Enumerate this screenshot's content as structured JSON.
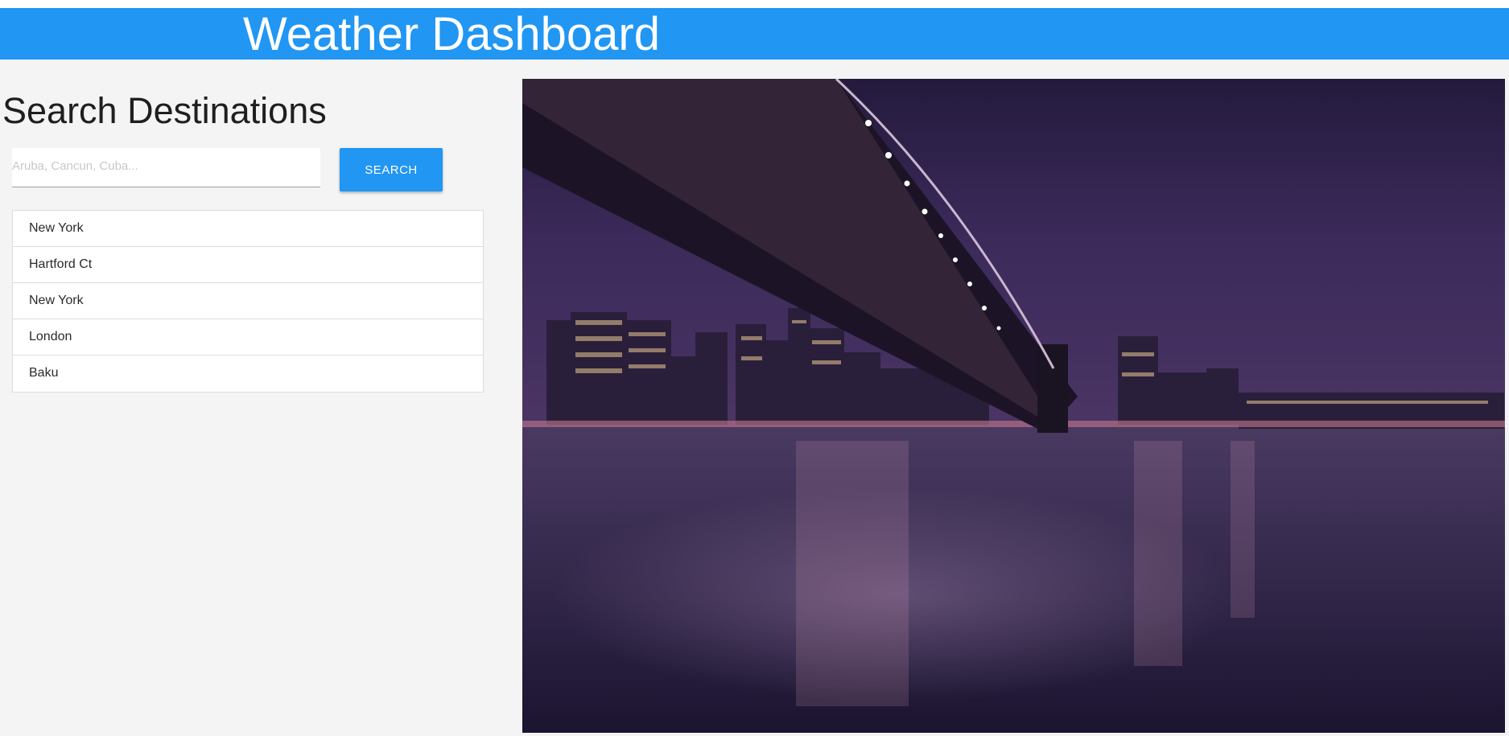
{
  "header": {
    "title": "Weather Dashboard"
  },
  "sidebar": {
    "title": "Search Destinations",
    "search": {
      "placeholder": "Aruba, Cancun, Cuba...",
      "value": ""
    },
    "search_button_label": "SEARCH",
    "history": [
      {
        "label": "New York"
      },
      {
        "label": "Hartford Ct"
      },
      {
        "label": "New York"
      },
      {
        "label": "London"
      },
      {
        "label": "Baku"
      }
    ]
  },
  "colors": {
    "header_bg": "#2196f3",
    "button_bg": "#2196f3",
    "page_bg": "#f4f4f4"
  }
}
